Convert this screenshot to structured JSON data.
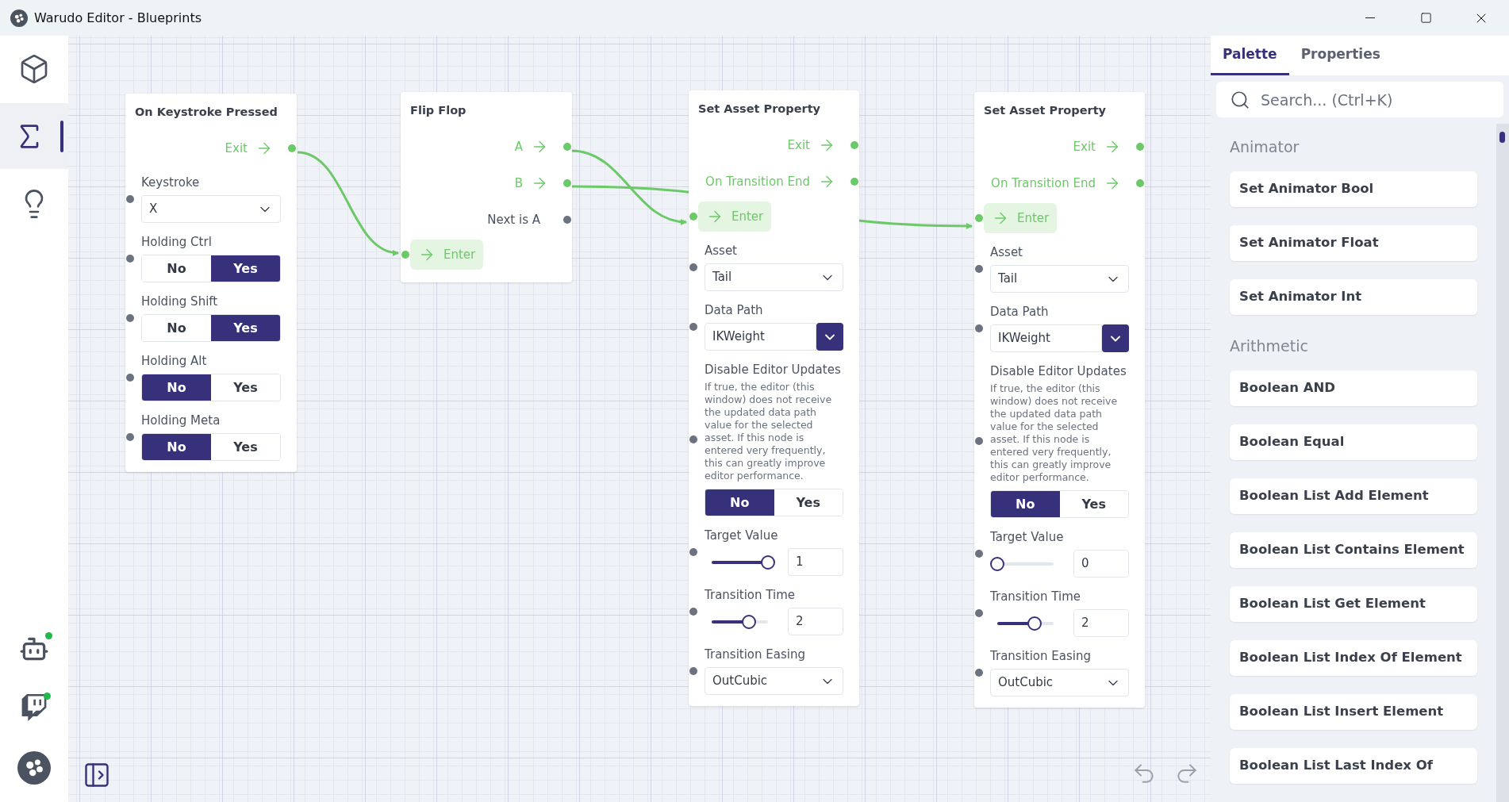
{
  "window": {
    "title": "Warudo Editor - Blueprints"
  },
  "sidebar": {
    "top_items": [
      {
        "selected": false
      },
      {
        "selected": true
      },
      {
        "selected": false
      }
    ],
    "bottom_items": [
      {
        "online": true
      },
      {
        "online": true
      },
      {
        "online": false
      }
    ]
  },
  "nodes": [
    {
      "title": "On Keystroke Pressed",
      "outputs": [
        {
          "kind": "flow",
          "label": "Exit"
        }
      ],
      "fields": [
        {
          "kind": "dropdown",
          "label": "Keystroke",
          "value": "X"
        },
        {
          "kind": "toggle",
          "label": "Holding Ctrl",
          "options": [
            {
              "label": "No",
              "selected": false
            },
            {
              "label": "Yes",
              "selected": true
            }
          ]
        },
        {
          "kind": "toggle",
          "label": "Holding Shift",
          "options": [
            {
              "label": "No",
              "selected": false
            },
            {
              "label": "Yes",
              "selected": true
            }
          ]
        },
        {
          "kind": "toggle",
          "label": "Holding Alt",
          "options": [
            {
              "label": "No",
              "selected": true
            },
            {
              "label": "Yes",
              "selected": false
            }
          ]
        },
        {
          "kind": "toggle",
          "label": "Holding Meta",
          "options": [
            {
              "label": "No",
              "selected": true
            },
            {
              "label": "Yes",
              "selected": false
            }
          ]
        }
      ]
    },
    {
      "title": "Flip Flop",
      "outputs": [
        {
          "kind": "flow",
          "label": "A"
        },
        {
          "kind": "flow",
          "label": "B"
        },
        {
          "kind": "data",
          "label": "Next is A"
        }
      ],
      "inputs": [
        {
          "label": "Enter"
        }
      ]
    },
    {
      "title": "Set Asset Property",
      "outputs": [
        {
          "kind": "flow",
          "label": "Exit"
        },
        {
          "kind": "flow",
          "label": "On Transition End"
        }
      ],
      "inputs": [
        {
          "label": "Enter"
        }
      ],
      "fields": [
        {
          "kind": "dropdown",
          "label": "Asset",
          "value": "Tail"
        },
        {
          "kind": "combo",
          "label": "Data Path",
          "value": "IKWeight"
        },
        {
          "kind": "toggle",
          "label": "Disable Editor Updates",
          "description": "If true, the editor (this window) does not receive the updated data path value for the selected asset. If this node is entered very frequently, this can greatly improve editor performance.",
          "options": [
            {
              "label": "No",
              "selected": true
            },
            {
              "label": "Yes",
              "selected": false
            }
          ]
        },
        {
          "kind": "slider",
          "label": "Target Value",
          "level": 1,
          "value": "1"
        },
        {
          "kind": "slider",
          "label": "Transition Time",
          "level": 0.66,
          "value": "2"
        },
        {
          "kind": "dropdown",
          "label": "Transition Easing",
          "value": "OutCubic"
        }
      ]
    },
    {
      "title": "Set Asset Property",
      "outputs": [
        {
          "kind": "flow",
          "label": "Exit"
        },
        {
          "kind": "flow",
          "label": "On Transition End"
        }
      ],
      "inputs": [
        {
          "label": "Enter"
        }
      ],
      "fields": [
        {
          "kind": "dropdown",
          "label": "Asset",
          "value": "Tail"
        },
        {
          "kind": "combo",
          "label": "Data Path",
          "value": "IKWeight"
        },
        {
          "kind": "toggle",
          "label": "Disable Editor Updates",
          "description": "If true, the editor (this window) does not receive the updated data path value for the selected asset. If this node is entered very frequently, this can greatly improve editor performance.",
          "options": [
            {
              "label": "No",
              "selected": true
            },
            {
              "label": "Yes",
              "selected": false
            }
          ]
        },
        {
          "kind": "slider",
          "label": "Target Value",
          "level": 0,
          "value": "0"
        },
        {
          "kind": "slider",
          "label": "Transition Time",
          "level": 0.66,
          "value": "2"
        },
        {
          "kind": "dropdown",
          "label": "Transition Easing",
          "value": "OutCubic"
        }
      ]
    }
  ],
  "panel": {
    "tabs": [
      {
        "label": "Palette",
        "selected": true
      },
      {
        "label": "Properties",
        "selected": false
      }
    ],
    "search": {
      "placeholder": "Search... (Ctrl+K)"
    },
    "sections": [
      {
        "title": "Animator",
        "items": [
          "Set Animator Bool",
          "Set Animator Float",
          "Set Animator Int"
        ]
      },
      {
        "title": "Arithmetic",
        "items": [
          "Boolean AND",
          "Boolean Equal",
          "Boolean List Add Element",
          "Boolean List Contains Element",
          "Boolean List Get Element",
          "Boolean List Index Of Element",
          "Boolean List Insert Element",
          "Boolean List Last Index Of"
        ]
      }
    ]
  }
}
